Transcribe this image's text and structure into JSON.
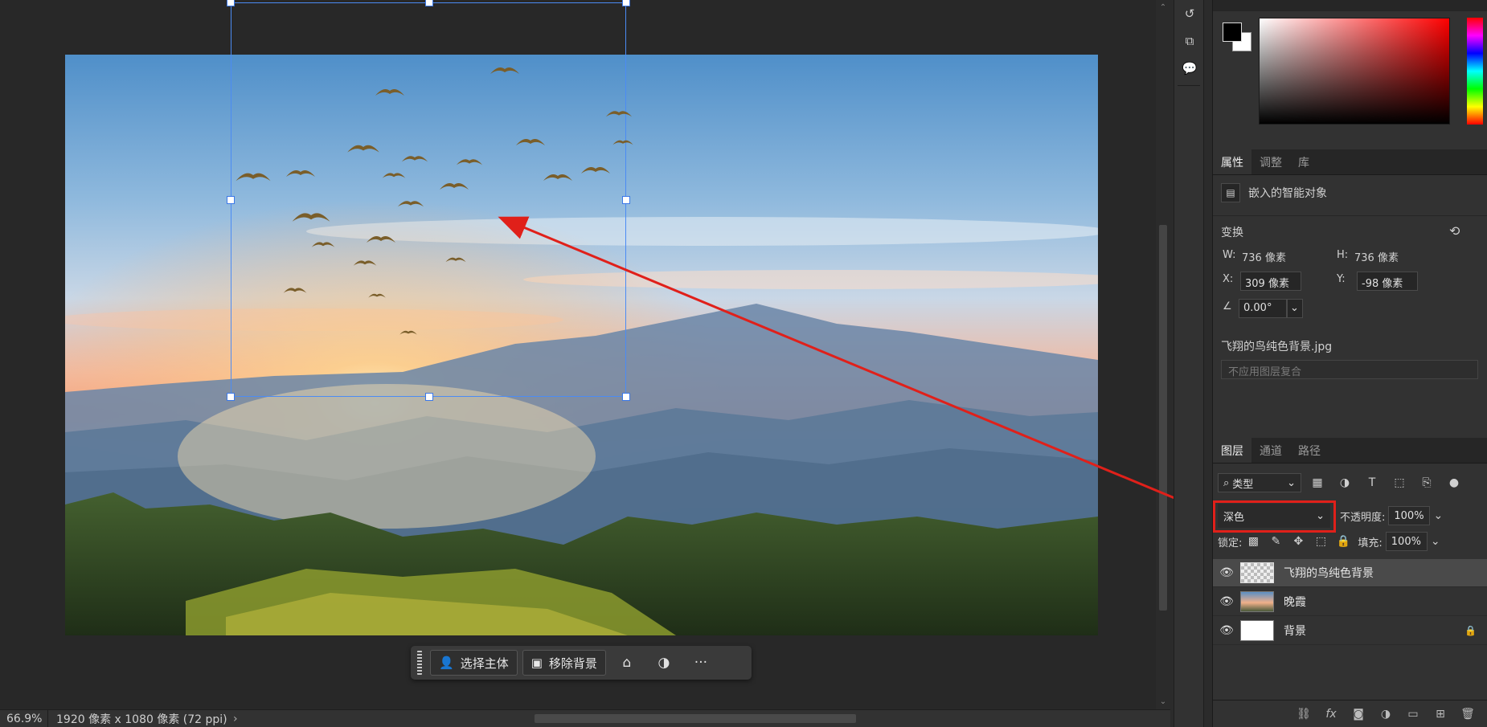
{
  "canvas": {
    "task_bar": {
      "select_subject_label": "选择主体",
      "remove_bg_label": "移除背景",
      "more_label": "···"
    }
  },
  "status_bar": {
    "zoom": "66.9%",
    "doc_info": "1920 像素 x 1080 像素 (72 ppi)",
    "expand_glyph": "›"
  },
  "properties": {
    "tabs": [
      "属性",
      "调整",
      "库"
    ],
    "object_type": "嵌入的智能对象",
    "transform_title": "变换",
    "w_label": "W:",
    "w_value": "736 像素",
    "h_label": "H:",
    "h_value": "736 像素",
    "x_label": "X:",
    "x_value": "309 像素",
    "y_label": "Y:",
    "y_value": "-98 像素",
    "angle_value": "0.00°",
    "file_name": "飞翔的鸟纯色背景.jpg",
    "layer_comp_placeholder": "不应用图层复合"
  },
  "layers": {
    "tabs": [
      "图层",
      "通道",
      "路径"
    ],
    "filter_kind": "类型",
    "blend_mode": "深色",
    "opacity_label": "不透明度:",
    "opacity_value": "100%",
    "lock_label": "锁定:",
    "fill_label": "填充:",
    "fill_value": "100%",
    "items": [
      {
        "name": "飞翔的鸟纯色背景",
        "selected": true
      },
      {
        "name": "晚霞",
        "selected": false
      },
      {
        "name": "背景",
        "selected": false,
        "locked": true
      }
    ]
  },
  "colors": {
    "accent_blue": "#4b8bf4",
    "annotation_red": "#e0201a",
    "foreground": "#000000",
    "background": "#ffffff"
  }
}
